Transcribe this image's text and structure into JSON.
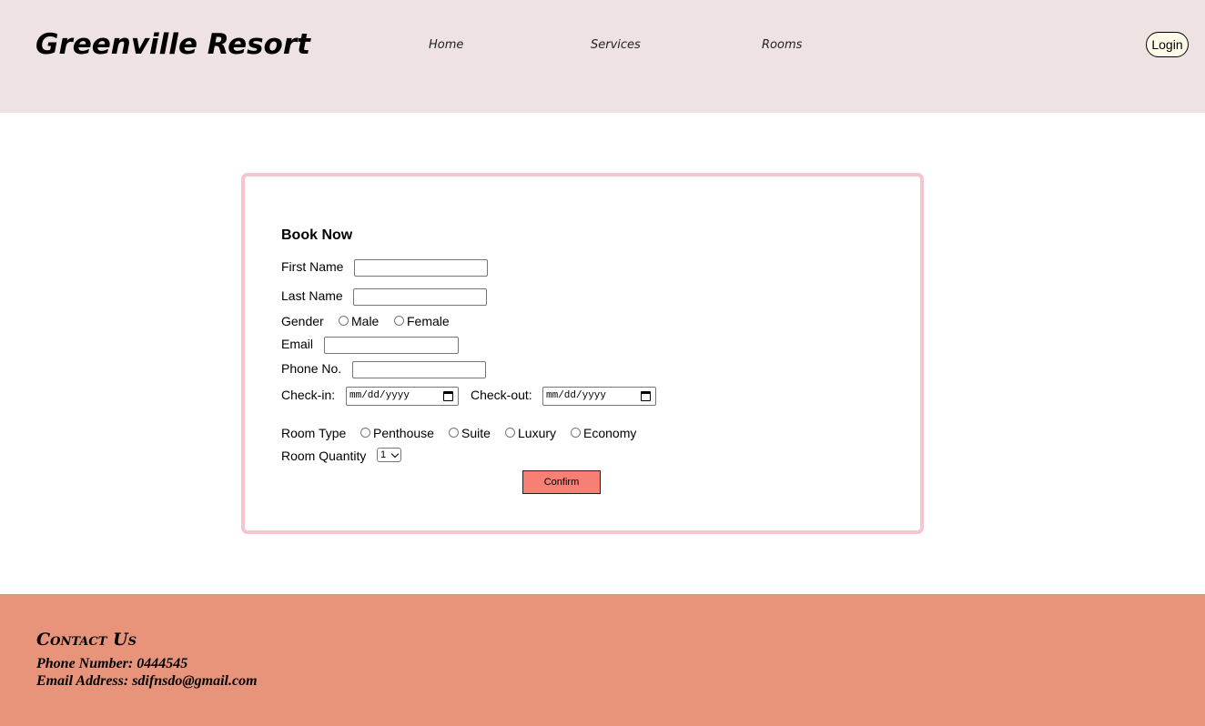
{
  "header": {
    "brand": "Greenville Resort",
    "nav": {
      "home": "Home",
      "services": "Services",
      "rooms": "Rooms"
    },
    "login_label": "Login"
  },
  "form": {
    "title": "Book Now",
    "first_name_label": "First Name",
    "first_name_value": "",
    "last_name_label": "Last Name",
    "last_name_value": "",
    "gender_label": "Gender",
    "gender_options": [
      "Male",
      "Female"
    ],
    "email_label": "Email",
    "email_value": "",
    "phone_label": "Phone No.",
    "phone_value": "",
    "checkin_label": "Check-in:",
    "checkin_placeholder": "mm/dd/yyyy",
    "checkout_label": "Check-out:",
    "checkout_placeholder": "mm/dd/yyyy",
    "room_type_label": "Room Type",
    "room_type_options": [
      "Penthouse",
      "Suite",
      "Luxury",
      "Economy"
    ],
    "room_quantity_label": "Room Quantity",
    "room_quantity_value": "1",
    "confirm_label": "Confirm"
  },
  "footer": {
    "title": "Contact Us",
    "phone_line": "Phone Number: 0444545",
    "email_line": "Email Address: sdifnsdo@gmail.com"
  },
  "colors": {
    "header_bg": "#efe2e3",
    "card_border": "#f6c6cf",
    "confirm_bg": "#f87f74",
    "footer_bg": "#e8947a",
    "login_bg": "#fffbe8"
  }
}
